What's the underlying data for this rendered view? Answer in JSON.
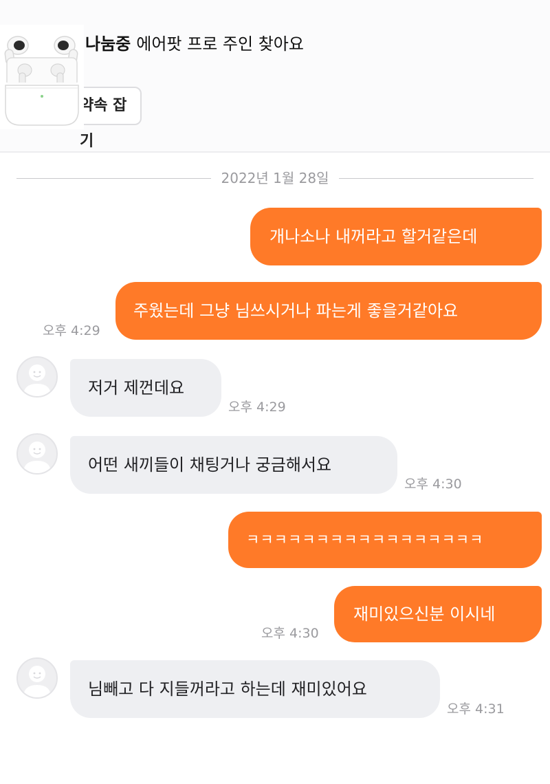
{
  "header": {
    "product": {
      "status": "나눔중",
      "title": "에어팟 프로 주인 찾아요",
      "image_icon": "airpods-pro-image"
    },
    "appointment_button": "약속 잡기"
  },
  "date_divider": "2022년 1월 28일",
  "messages": [
    {
      "sender": "me",
      "text": "개나소나 내꺼라고 할거같은데",
      "time": ""
    },
    {
      "sender": "me",
      "text": "주웠는데 그냥 님쓰시거나 파는게 좋을거같아요",
      "time": "오후 4:29"
    },
    {
      "sender": "other",
      "text": "저거 제껀데요",
      "time": "오후 4:29"
    },
    {
      "sender": "other",
      "text": "어떤 새끼들이 채팅거나 궁금해서요",
      "time": "오후 4:30"
    },
    {
      "sender": "me",
      "text": "ㅋㅋㅋㅋㅋㅋㅋㅋㅋㅋㅋㅋㅋㅋㅋㅋㅋ",
      "time": ""
    },
    {
      "sender": "me",
      "text": "재미있으신분 이시네",
      "time": "오후 4:30"
    },
    {
      "sender": "other",
      "text": "님빼고 다 지들꺼라고 하는데 재미있어요",
      "time": "오후 4:31"
    }
  ],
  "colors": {
    "my_bubble": "#ff7a28",
    "other_bubble": "#eeeff2",
    "timestamp": "#9a9a9e"
  },
  "icons": {
    "avatar": "default-user-avatar-icon"
  }
}
